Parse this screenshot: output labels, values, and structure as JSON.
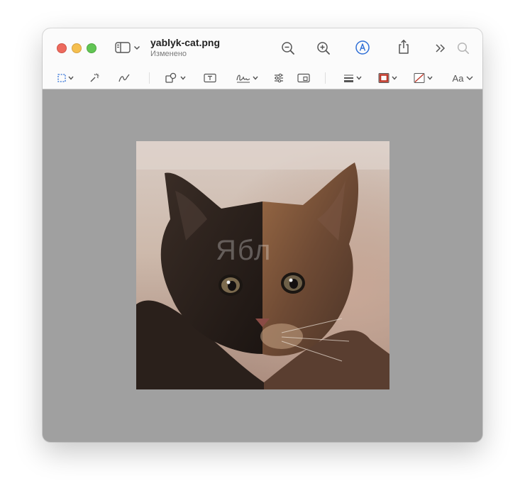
{
  "window": {
    "title": "yablyk-cat.png",
    "subtitle": "Изменено"
  },
  "titlebar_icons": [
    "sidebar-icon",
    "chevron-down-icon",
    "zoom-out-icon",
    "zoom-in-icon",
    "markup-icon",
    "share-icon",
    "more-icon",
    "search-icon"
  ],
  "toolbar": {
    "text_style_label": "Aa"
  },
  "toolbar_icons": [
    "rectangular-selection-icon",
    "instant-alpha-icon",
    "sketch-icon",
    "shapes-icon",
    "text-box-icon",
    "signature-icon",
    "adjust-color-icon",
    "adjust-size-icon",
    "shape-style-icon",
    "border-color-icon",
    "fill-color-icon",
    "text-style-icon"
  ],
  "image": {
    "watermark": "Ябл"
  },
  "colors": {
    "close": "#ed6a5e",
    "minimize": "#f5bf4f",
    "maximize": "#61c554",
    "markup_accent": "#2f6fd6",
    "border_color_swatch": "#c0392b",
    "canvas_background": "#a0a0a0"
  }
}
